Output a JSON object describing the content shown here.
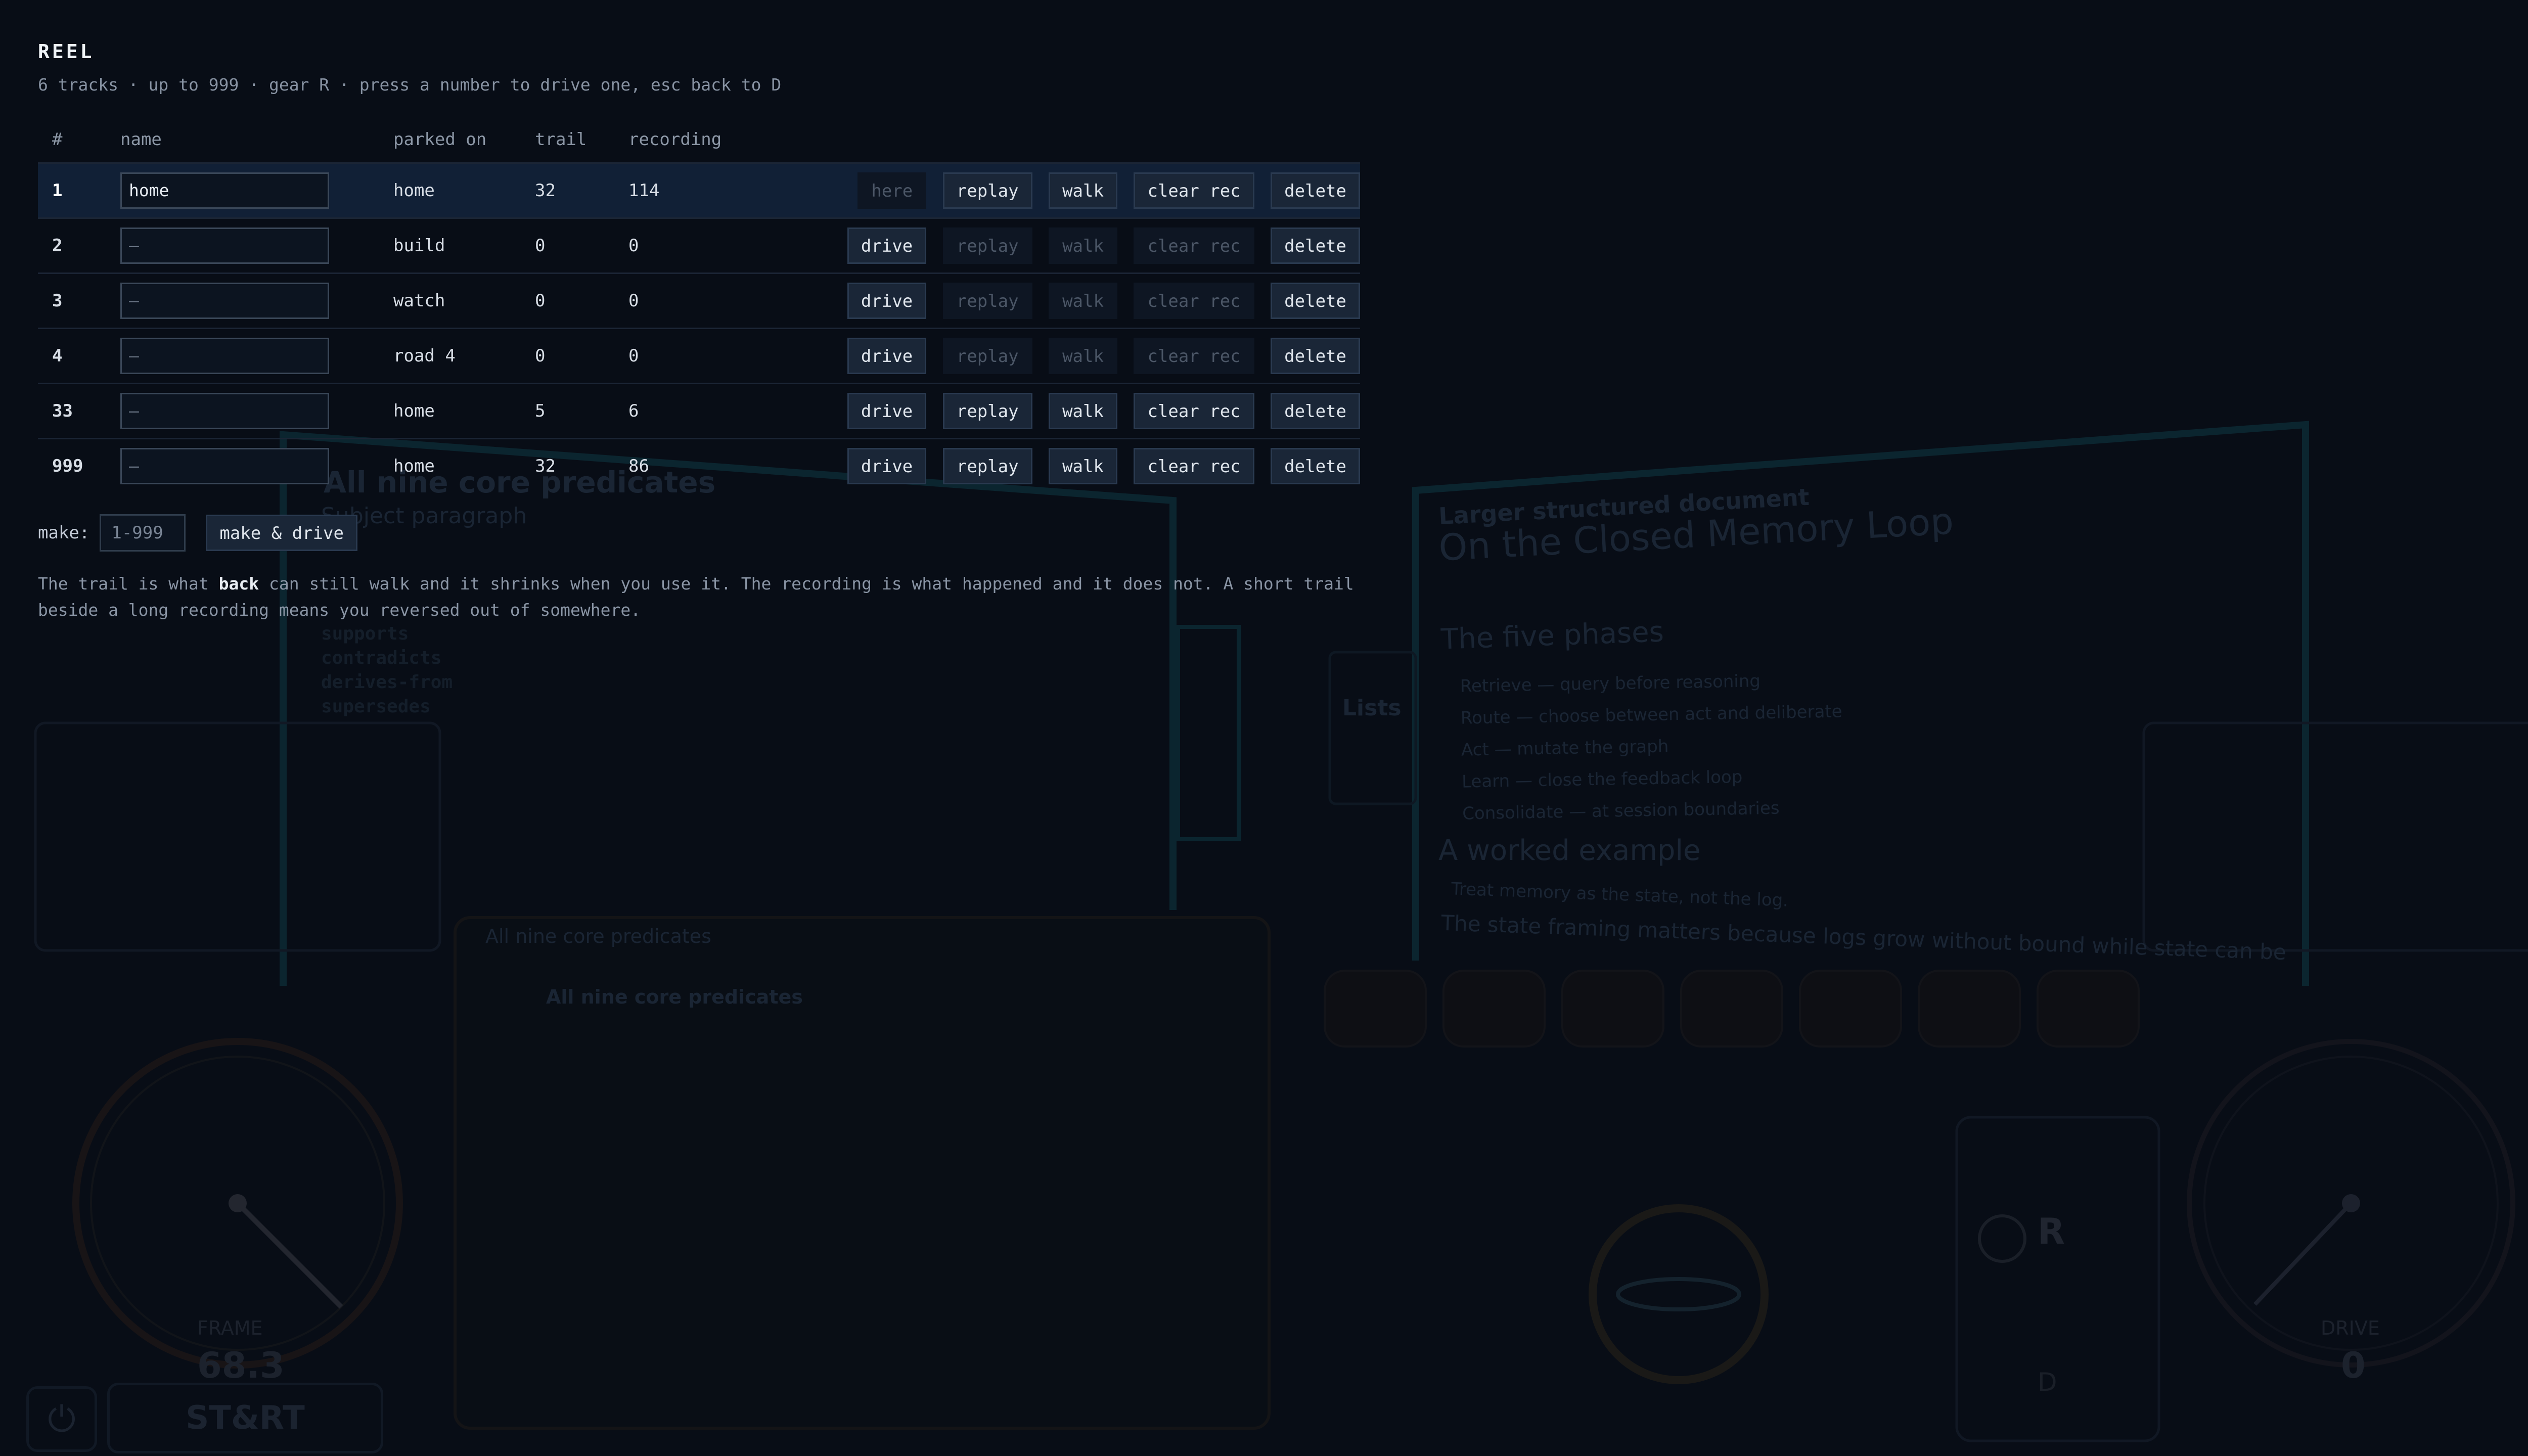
{
  "title": "REEL",
  "subtitle": "6 tracks · up to 999 · gear R · press a number to drive one, esc back to D",
  "columns": [
    "#",
    "name",
    "parked on",
    "trail",
    "recording"
  ],
  "rows": [
    {
      "num": "1",
      "name": "home",
      "parked": "home",
      "trail": "32",
      "recording": "114",
      "first": "here",
      "active": true
    },
    {
      "num": "2",
      "name": "–",
      "parked": "build",
      "trail": "0",
      "recording": "0",
      "first": "drive"
    },
    {
      "num": "3",
      "name": "–",
      "parked": "watch",
      "trail": "0",
      "recording": "0",
      "first": "drive"
    },
    {
      "num": "4",
      "name": "–",
      "parked": "road 4",
      "trail": "0",
      "recording": "0",
      "first": "drive"
    },
    {
      "num": "33",
      "name": "–",
      "parked": "home",
      "trail": "5",
      "recording": "6",
      "first": "drive"
    },
    {
      "num": "999",
      "name": "–",
      "parked": "home",
      "trail": "32",
      "recording": "86",
      "first": "drive"
    }
  ],
  "actions": {
    "replay": "replay",
    "walk": "walk",
    "clear": "clear rec",
    "delete": "delete"
  },
  "make": {
    "label": "make:",
    "placeholder": "1-999",
    "button": "make & drive"
  },
  "note": {
    "part1": "The trail is what ",
    "bold": "back",
    "part2": " can still walk and it shrinks when you use it. The recording is what happened and it does not. A short trail beside a long recording means you reversed out of somewhere."
  },
  "background": {
    "doc_kicker": "Larger structured document",
    "doc_title": "On the Closed Memory Loop",
    "doc_h2a": "The five phases",
    "doc_phases": [
      "Retrieve — query before reasoning",
      "Route — choose between act and deliberate",
      "Act — mutate the graph",
      "Learn — close the feedback loop",
      "Consolidate — at session boundaries"
    ],
    "doc_h2b": "A worked example",
    "doc_line": "Treat memory as the state, not the log.",
    "doc_line2": "The state framing matters because logs grow without bound while state can be",
    "pred_title": "All nine core predicates",
    "pred_sub": "Subject paragraph",
    "pred_list": [
      "supports",
      "contradicts",
      "derives-from",
      "supersedes"
    ],
    "panel_title": "All nine core predicates",
    "lists_label": "Lists",
    "gear": "R",
    "gear2": "D",
    "left_gauge_label": "FRAME",
    "left_gauge_value": "68.3",
    "right_gauge_label": "DRIVE",
    "right_gauge_value": "0",
    "start_label": "ST&RT"
  },
  "colors": {
    "accent": "#3fd8e8",
    "bg": "#080d16",
    "active_row": "#112036"
  }
}
